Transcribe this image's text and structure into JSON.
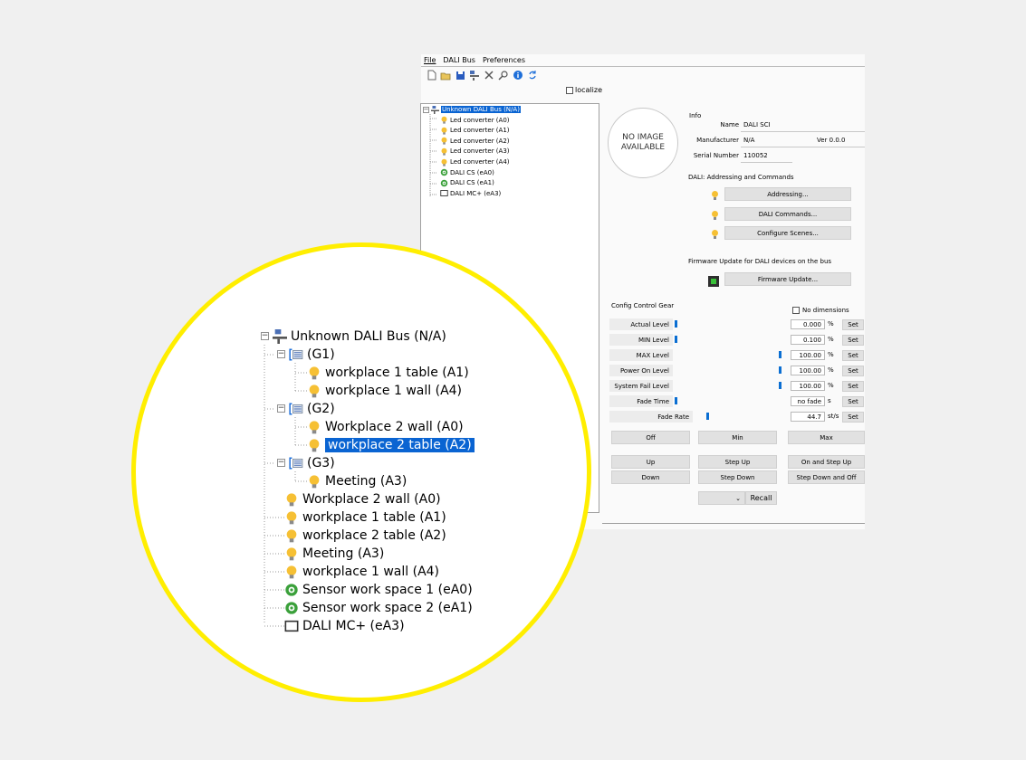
{
  "menu": [
    "File",
    "DALI Bus",
    "Preferences"
  ],
  "toolbar_icons": [
    "new-file-icon",
    "open-folder-icon",
    "save-icon",
    "bus-icon",
    "tools-icon",
    "search-icon",
    "info-icon",
    "refresh-icon"
  ],
  "localize_label": "localize",
  "small_tree": [
    {
      "label": "Unknown DALI Bus (N/A)",
      "icon": "bus-icon",
      "selected": true
    },
    {
      "label": "Led converter (A0)",
      "icon": "bulb-icon"
    },
    {
      "label": "Led converter (A1)",
      "icon": "bulb-icon"
    },
    {
      "label": "Led converter (A2)",
      "icon": "bulb-icon"
    },
    {
      "label": "Led converter (A3)",
      "icon": "bulb-icon"
    },
    {
      "label": "Led converter (A4)",
      "icon": "bulb-icon"
    },
    {
      "label": "DALI CS (eA0)",
      "icon": "sensor-icon"
    },
    {
      "label": "DALI CS (eA1)",
      "icon": "sensor-icon"
    },
    {
      "label": "DALI MC+ (eA3)",
      "icon": "module-icon"
    }
  ],
  "no_image_text": "NO IMAGE AVAILABLE",
  "info": {
    "heading": "Info",
    "name_label": "Name",
    "name_value": "DALI SCI",
    "manufacturer_label": "Manufacturer",
    "manufacturer_value": "N/A",
    "version_value": "Ver 0.0.0",
    "serial_label": "Serial Number",
    "serial_value": "110052"
  },
  "addressing": {
    "heading": "DALI: Addressing and Commands",
    "buttons": [
      "Addressing...",
      "DALI Commands...",
      "Configure Scenes..."
    ]
  },
  "firmware": {
    "heading": "Firmware Update for DALI devices on the bus",
    "button": "Firmware Update..."
  },
  "config": {
    "heading": "Config Control Gear",
    "no_dimensions_label": "No dimensions",
    "set_label": "Set",
    "rows": [
      {
        "label": "Actual Level",
        "value": "0.000",
        "unit": "%",
        "level": 0.0
      },
      {
        "label": "MIN Level",
        "value": "0.100",
        "unit": "%",
        "level": 0.0
      },
      {
        "label": "MAX Level",
        "value": "100.00",
        "unit": "%",
        "level": 1.0
      },
      {
        "label": "Power On Level",
        "value": "100.00",
        "unit": "%",
        "level": 1.0
      },
      {
        "label": "System Fail Level",
        "value": "100.00",
        "unit": "%",
        "level": 1.0
      },
      {
        "label": "Fade Time",
        "value": "no fade",
        "unit": "s",
        "level": 0.0
      },
      {
        "label": "Fade Rate",
        "value": "44.7",
        "unit": "st/s",
        "level": 0.3
      }
    ],
    "commands": [
      [
        "Off",
        "Min",
        "Max"
      ],
      [
        "Up",
        "Step Up",
        "On and Step Up"
      ],
      [
        "Down",
        "Step Down",
        "Step Down and Off"
      ]
    ],
    "recall_label": "Recall"
  },
  "zoom_tree": [
    {
      "label": "Unknown DALI Bus (N/A)",
      "icon": "bus-icon",
      "depth": 0
    },
    {
      "label": "(G1)",
      "icon": "group-icon",
      "depth": 1
    },
    {
      "label": "workplace 1 table (A1)",
      "icon": "bulb-icon",
      "depth": 2
    },
    {
      "label": "workplace 1 wall (A4)",
      "icon": "bulb-icon",
      "depth": 2
    },
    {
      "label": "(G2)",
      "icon": "group-icon",
      "depth": 1
    },
    {
      "label": "Workplace 2 wall (A0)",
      "icon": "bulb-icon",
      "depth": 2
    },
    {
      "label": "workplace 2 table (A2)",
      "icon": "bulb-icon",
      "depth": 2,
      "selected": true
    },
    {
      "label": "(G3)",
      "icon": "group-icon",
      "depth": 1
    },
    {
      "label": "Meeting (A3)",
      "icon": "bulb-icon",
      "depth": 2
    },
    {
      "label": "Workplace 2 wall (A0)",
      "icon": "bulb-icon",
      "depth": 1
    },
    {
      "label": "workplace 1 table (A1)",
      "icon": "bulb-icon",
      "depth": 1
    },
    {
      "label": "workplace 2 table (A2)",
      "icon": "bulb-icon",
      "depth": 1
    },
    {
      "label": "Meeting (A3)",
      "icon": "bulb-icon",
      "depth": 1
    },
    {
      "label": "workplace 1 wall (A4)",
      "icon": "bulb-icon",
      "depth": 1
    },
    {
      "label": "Sensor work space 1 (eA0)",
      "icon": "sensor-icon",
      "depth": 1
    },
    {
      "label": "Sensor work space 2 (eA1)",
      "icon": "sensor-icon",
      "depth": 1
    },
    {
      "label": "DALI MC+ (eA3)",
      "icon": "module-icon",
      "depth": 1
    }
  ],
  "colors": {
    "selection": "#0a64d2",
    "level_bar": "#0a6ed2",
    "highlight_ring": "#ffee00",
    "bulb": "#f6c034",
    "sensor": "#3aa03a"
  }
}
